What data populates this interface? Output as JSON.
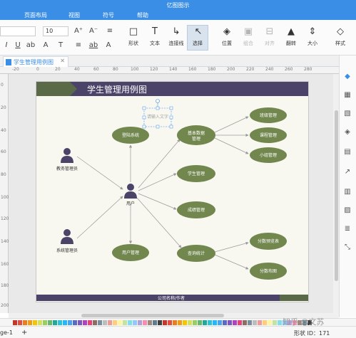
{
  "app": {
    "title": "亿图图示"
  },
  "menu": {
    "items": [
      "页面布局",
      "视图",
      "符号",
      "帮助"
    ]
  },
  "ribbon": {
    "font_size": "10",
    "glyphs": [
      "A⁺",
      "A⁻",
      "≡",
      "I",
      "U",
      "ab",
      "A",
      "T",
      "≡",
      "ab",
      "A"
    ],
    "tools": [
      {
        "label": "形状",
        "icon": "□"
      },
      {
        "label": "文本",
        "icon": "T"
      },
      {
        "label": "连接线",
        "icon": "↳"
      },
      {
        "label": "选择",
        "icon": "↖"
      },
      {
        "label": "位置",
        "icon": "◈"
      },
      {
        "label": "组合",
        "icon": "▣"
      },
      {
        "label": "对齐",
        "icon": "⊟"
      },
      {
        "label": "翻转",
        "icon": "▲"
      },
      {
        "label": "大小",
        "icon": "⇕"
      },
      {
        "label": "样式",
        "icon": "◇"
      }
    ]
  },
  "tab": {
    "label": "学生管理用例图"
  },
  "ruler": {
    "h": [
      "-20",
      "0",
      "20",
      "40",
      "60",
      "80",
      "100",
      "120",
      "140",
      "160",
      "180",
      "200",
      "220",
      "240",
      "260",
      "280"
    ],
    "v": [
      "0",
      "20",
      "40",
      "60",
      "80",
      "100",
      "120",
      "140",
      "160",
      "180",
      "200"
    ]
  },
  "diagram": {
    "title": "学生管理用例图",
    "footer": "公司名称/作者",
    "selected_placeholder": "请输入文字",
    "actors": [
      "教务管理员",
      "用户",
      "系统管理员"
    ],
    "usecases": [
      "登陆系统",
      "基本数据\n管理",
      "学生管理",
      "成绩管理",
      "查询统计",
      "用户管理",
      "班级管理",
      "课程管理",
      "小组管理",
      "分数预览表",
      "分数布图"
    ]
  },
  "status": {
    "page": "ge-1",
    "add": "+",
    "shape_id": "形状 ID：171"
  },
  "watermark": "知乎 @文苏",
  "colors": {
    "accent": "#3a8ee6",
    "header_band": "#4b4368",
    "header_green": "#5a6a48",
    "usecase_fill": "#71874e",
    "actor_fill": "#4b4368",
    "page_bg": "#f8f7f0"
  }
}
